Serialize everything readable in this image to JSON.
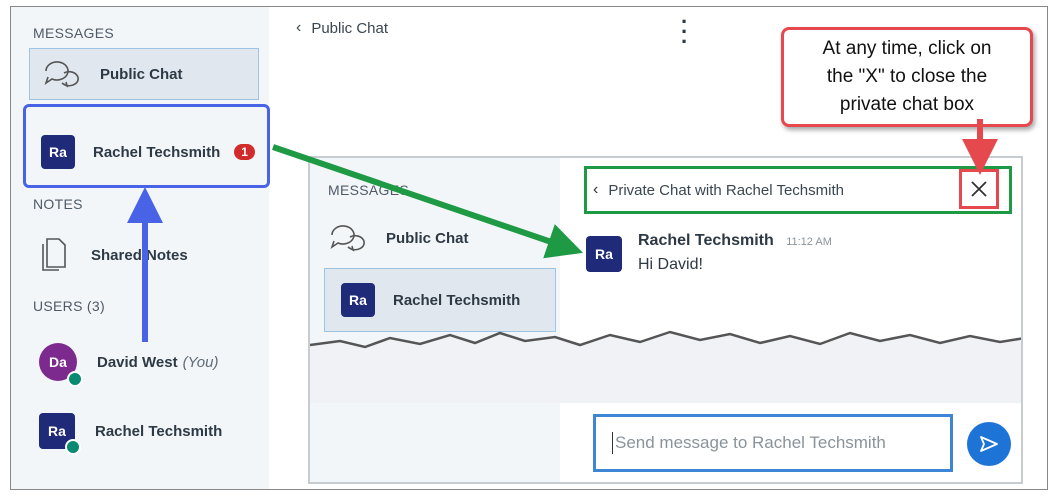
{
  "sidebar": {
    "messages_label": "MESSAGES",
    "public_chat": "Public Chat",
    "private_chat": {
      "initials": "Ra",
      "name": "Rachel Techsmith",
      "unread": "1"
    },
    "notes_label": "NOTES",
    "shared_notes": "Shared Notes",
    "users_label": "USERS (3)",
    "users": [
      {
        "initials": "Da",
        "name": "David West",
        "suffix": "(You)"
      },
      {
        "initials": "Ra",
        "name": "Rachel Techsmith",
        "suffix": ""
      }
    ]
  },
  "main": {
    "title": "Public Chat"
  },
  "callout": {
    "lines": [
      "At any time, click on",
      "the \"X\" to close the",
      "private chat box"
    ]
  },
  "zoom": {
    "messages_label": "MESSAGES",
    "public_chat": "Public Chat",
    "private_item": {
      "initials": "Ra",
      "name": "Rachel Techsmith"
    },
    "header_title": "Private Chat with Rachel Techsmith",
    "message": {
      "initials": "Ra",
      "author": "Rachel Techsmith",
      "time": "11:12 AM",
      "text": "Hi David!"
    },
    "input_placeholder": "Send message to Rachel Techsmith"
  },
  "colors": {
    "blue_highlight": "#4863e6",
    "green_highlight": "#1f9a44",
    "red_highlight": "#e5484d",
    "unread": "#d22b2b",
    "avatar": "#1f2a78"
  }
}
